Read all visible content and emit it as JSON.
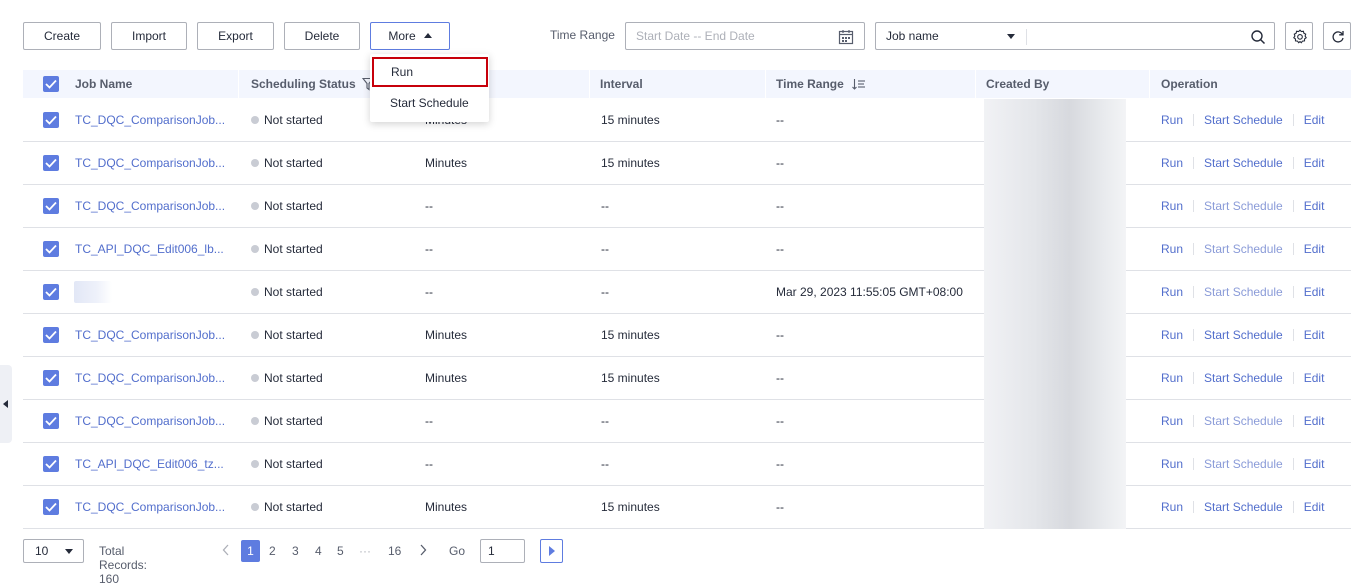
{
  "toolbar": {
    "create": "Create",
    "import": "Import",
    "export": "Export",
    "delete": "Delete",
    "more": "More"
  },
  "more_menu": [
    "Run",
    "Start Schedule"
  ],
  "filters": {
    "time_range_label": "Time Range",
    "date_placeholder": "Start Date -- End Date",
    "job_select_value": "Job name",
    "search_value": ""
  },
  "table": {
    "headers": {
      "job_name": "Job Name",
      "scheduling_status": "Scheduling Status",
      "interval": "Interval",
      "time_range": "Time Range",
      "created_by": "Created By",
      "operation": "Operation"
    },
    "operations": {
      "run": "Run",
      "start_schedule": "Start Schedule",
      "edit": "Edit"
    },
    "rows": [
      {
        "name": "TC_DQC_ComparisonJob...",
        "status": "Not started",
        "unit": "Minutes",
        "interval": "15 minutes",
        "time_range": "--",
        "schedule_enabled": true
      },
      {
        "name": "TC_DQC_ComparisonJob...",
        "status": "Not started",
        "unit": "Minutes",
        "interval": "15 minutes",
        "time_range": "--",
        "schedule_enabled": true
      },
      {
        "name": "TC_DQC_ComparisonJob...",
        "status": "Not started",
        "unit": "--",
        "interval": "--",
        "time_range": "--",
        "schedule_enabled": false
      },
      {
        "name": "TC_API_DQC_Edit006_lb...",
        "status": "Not started",
        "unit": "--",
        "interval": "--",
        "time_range": "--",
        "schedule_enabled": false
      },
      {
        "name": "",
        "status": "Not started",
        "unit": "--",
        "interval": "--",
        "time_range": "Mar 29, 2023 11:55:05 GMT+08:00",
        "schedule_enabled": false
      },
      {
        "name": "TC_DQC_ComparisonJob...",
        "status": "Not started",
        "unit": "Minutes",
        "interval": "15 minutes",
        "time_range": "--",
        "schedule_enabled": true
      },
      {
        "name": "TC_DQC_ComparisonJob...",
        "status": "Not started",
        "unit": "Minutes",
        "interval": "15 minutes",
        "time_range": "--",
        "schedule_enabled": true
      },
      {
        "name": "TC_DQC_ComparisonJob...",
        "status": "Not started",
        "unit": "--",
        "interval": "--",
        "time_range": "--",
        "schedule_enabled": false
      },
      {
        "name": "TC_API_DQC_Edit006_tz...",
        "status": "Not started",
        "unit": "--",
        "interval": "--",
        "time_range": "--",
        "schedule_enabled": false
      },
      {
        "name": "TC_DQC_ComparisonJob...",
        "status": "Not started",
        "unit": "Minutes",
        "interval": "15 minutes",
        "time_range": "--",
        "schedule_enabled": true
      }
    ]
  },
  "pagination": {
    "page_size": "10",
    "total_records": "Total Records: 160",
    "pages": [
      "1",
      "2",
      "3",
      "4",
      "5",
      "···",
      "16"
    ],
    "current_page": "1",
    "go_label": "Go",
    "go_value": "1"
  },
  "colors": {
    "accent": "#5e7ce0",
    "link": "#526ecc",
    "highlight_border": "#c7000b",
    "status_dot": "#c9ccd4"
  },
  "icons": [
    "calendar-icon",
    "chevron-down-icon",
    "search-icon",
    "settings-icon",
    "refresh-icon",
    "filter-icon",
    "sort-icon",
    "check-icon",
    "chevron-left-icon",
    "chevron-right-icon",
    "play-icon"
  ]
}
